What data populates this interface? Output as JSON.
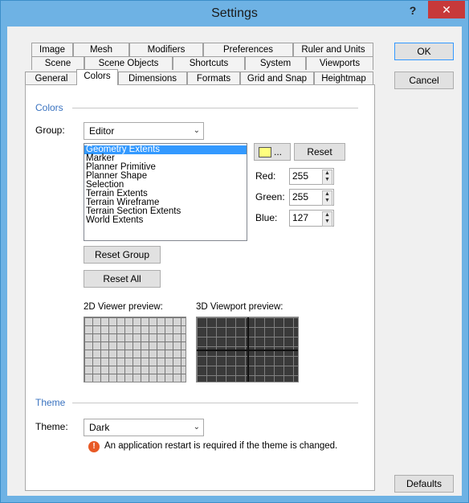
{
  "window": {
    "title": "Settings",
    "help_label": "?",
    "close_label": "✕"
  },
  "tabs": {
    "row1": [
      "Image",
      "Mesh",
      "Modifiers",
      "Preferences",
      "Ruler and Units"
    ],
    "row2": [
      "Scene",
      "Scene Objects",
      "Shortcuts",
      "System",
      "Viewports"
    ],
    "row3": [
      "General",
      "Colors",
      "Dimensions",
      "Formats",
      "Grid and Snap",
      "Heightmap"
    ],
    "active": "Colors"
  },
  "buttons": {
    "ok": "OK",
    "cancel": "Cancel",
    "defaults": "Defaults",
    "reset": "Reset",
    "color_more": "...",
    "reset_group": "Reset Group",
    "reset_all": "Reset All"
  },
  "colors_section": {
    "title": "Colors",
    "group_label": "Group:",
    "group_value": "Editor",
    "items": [
      "Geometry Extents",
      "Marker",
      "Planner Primitive",
      "Planner Shape",
      "Selection",
      "Terrain Extents",
      "Terrain Wireframe",
      "Terrain Section Extents",
      "World Extents"
    ],
    "selected_index": 0,
    "swatch_color": "#ffff7f",
    "red_label": "Red:",
    "red_value": "255",
    "green_label": "Green:",
    "green_value": "255",
    "blue_label": "Blue:",
    "blue_value": "127",
    "preview2d_label": "2D Viewer preview:",
    "preview3d_label": "3D Viewport preview:"
  },
  "theme_section": {
    "title": "Theme",
    "theme_label": "Theme:",
    "theme_value": "Dark",
    "warning_text": "An application restart is required if the theme is changed."
  }
}
